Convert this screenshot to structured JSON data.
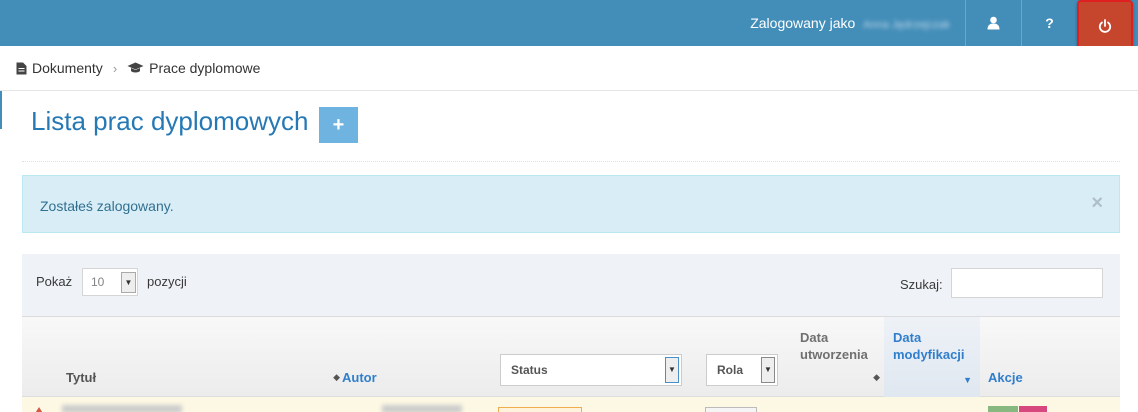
{
  "topbar": {
    "login_prefix": "Zalogowany jako",
    "login_user": "Anna Jędrzejczak",
    "buttons": [
      "user-icon",
      "help-icon",
      "power-icon"
    ],
    "help_label": "?"
  },
  "breadcrumb": {
    "items": [
      {
        "label": "Dokumenty",
        "icon": "file-icon"
      },
      {
        "label": "Prace dyplomowe",
        "icon": "graduation-cap-icon"
      }
    ],
    "separator": "›"
  },
  "page": {
    "title": "Lista prac dyplomowych",
    "add_label": "+"
  },
  "alert": {
    "message": "Zostałeś zalogowany.",
    "close_label": "×"
  },
  "table": {
    "length": {
      "prefix": "Pokaż",
      "value": "10",
      "suffix": "pozycji"
    },
    "search": {
      "label": "Szukaj:",
      "value": ""
    },
    "columns": {
      "title": "Tytuł",
      "author": "Autor",
      "status": "Status",
      "role": "Rola",
      "created_line1": "Data",
      "created_line2": "utworzenia",
      "modified_line1": "Data",
      "modified_line2": "modyfikacji",
      "actions": "Akcje"
    }
  },
  "colors": {
    "topbar": "#438eb9",
    "power": "#c6452d",
    "title": "#2679b5",
    "alert_bg": "#d9edf7",
    "row_warning": "#fcf8e3"
  }
}
